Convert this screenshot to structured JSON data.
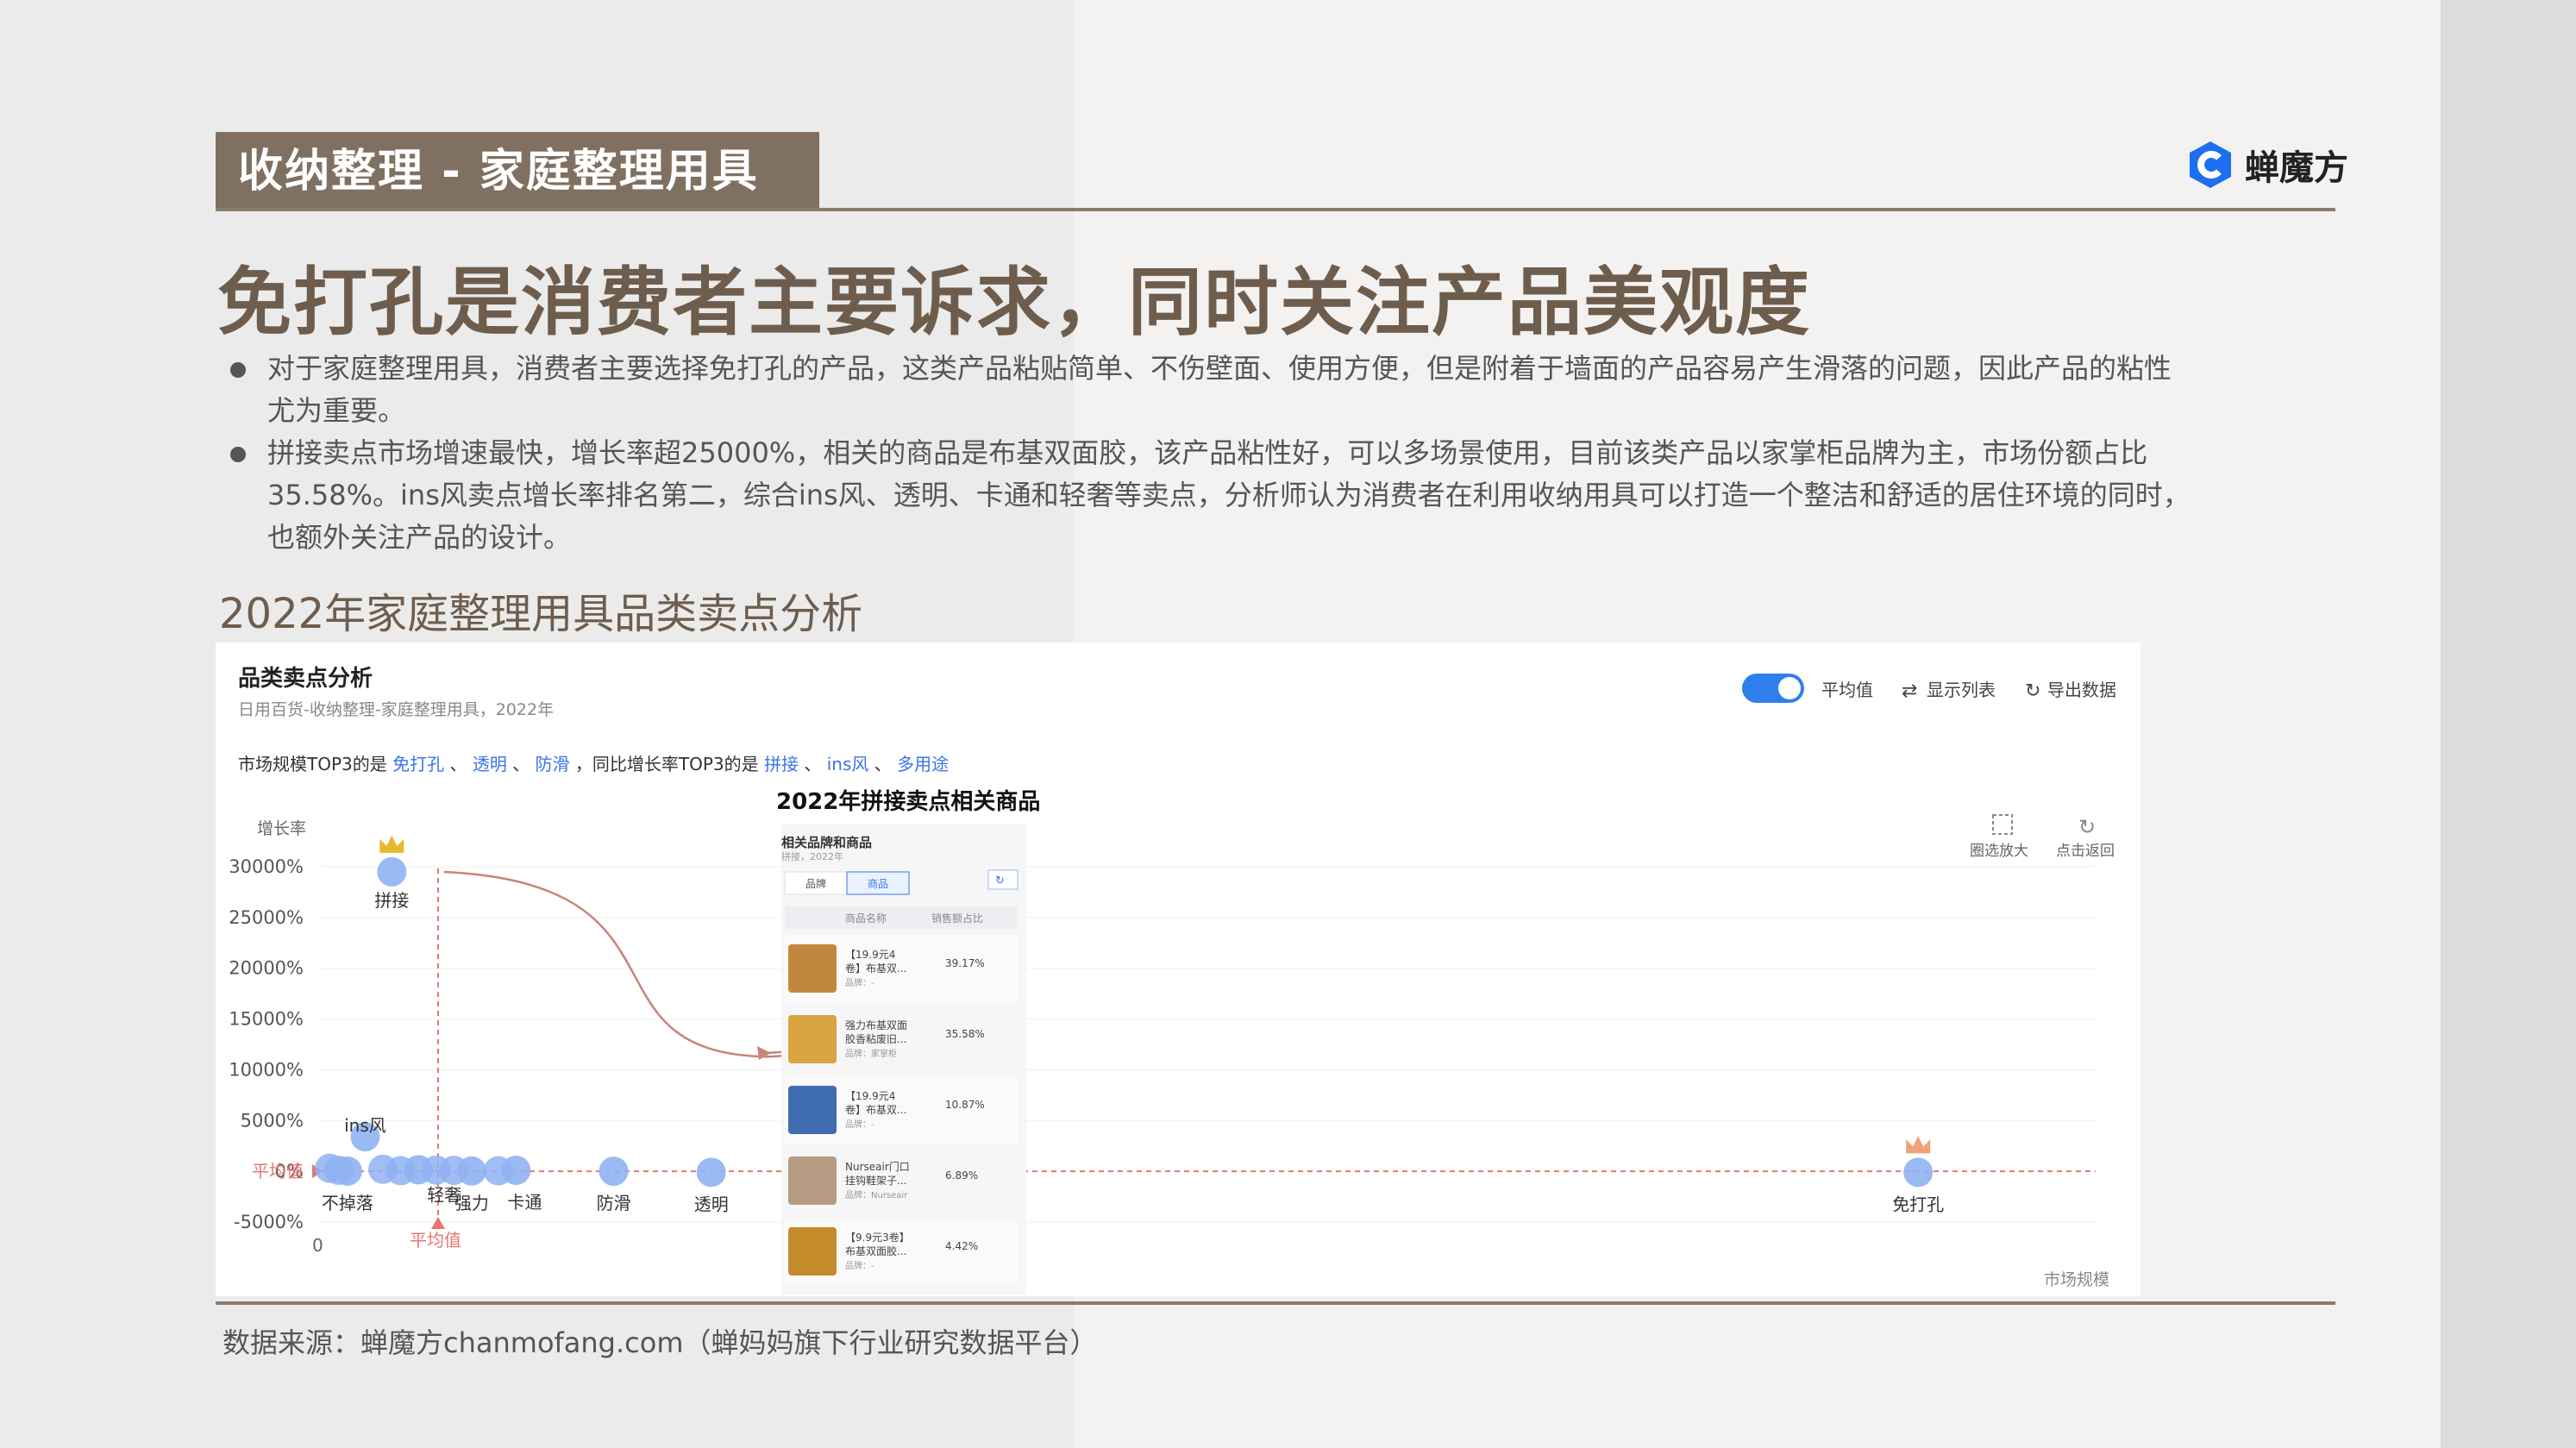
{
  "header": {
    "category_tag": "收纳整理 - 家庭整理用具",
    "brand_name": "蝉魔方"
  },
  "headline": "免打孔是消费者主要诉求，同时关注产品美观度",
  "bullets": [
    {
      "line1": "对于家庭整理用具，消费者主要选择免打孔的产品，这类产品粘贴简单、不伤壁面、使用方便，但是附着于墙面的产品容易产生滑落的问题，因此产品的粘性",
      "line2": "尤为重要。"
    },
    {
      "line1": "拼接卖点市场增速最快，增长率超25000%，相关的商品是布基双面胶，该产品粘性好，可以多场景使用，目前该类产品以家掌柜品牌为主，市场份额占比",
      "line2": "35.58%。ins风卖点增长率排名第二，综合ins风、透明、卡通和轻奢等卖点，分析师认为消费者在利用收纳用具可以打造一个整洁和舒适的居住环境的同时，",
      "line3": "也额外关注产品的设计。"
    }
  ],
  "section_title": "2022年家庭整理用具品类卖点分析",
  "panel": {
    "title": "品类卖点分析",
    "subtitle": "日用百货-收纳整理-家庭整理用具，2022年",
    "toggle_label": "平均值",
    "show_list_label": "显示列表",
    "export_label": "导出数据",
    "zoom_label": "圈选放大",
    "reset_label": "点击返回",
    "summary_prefix": "市场规模TOP3的是",
    "summary_top_size": [
      "免打孔",
      "透明",
      "防滑"
    ],
    "summary_mid": "，同比增长率TOP3的是",
    "summary_top_growth": [
      "拼接",
      "ins风",
      "多用途"
    ],
    "sep": "、"
  },
  "inset": {
    "caption": "2022年拼接卖点相关商品",
    "title": "相关品牌和商品",
    "subtitle": "拼接，2022年",
    "tabs": [
      "品牌",
      "商品"
    ],
    "col_name": "商品名称",
    "col_share": "销售额占比",
    "rows": [
      {
        "name1": "【19.9元4",
        "name2": "卷】布基双...",
        "brand": "品牌：-",
        "share": "39.17%",
        "color": "#c2873f"
      },
      {
        "name1": "强力布基双面",
        "name2": "胶香粘废旧...",
        "brand": "品牌：家掌柜",
        "share": "35.58%",
        "color": "#d9a441"
      },
      {
        "name1": "【19.9元4",
        "name2": "卷】布基双...",
        "brand": "品牌：-",
        "share": "10.87%",
        "color": "#3f6db0"
      },
      {
        "name1": "Nurseair门口",
        "name2": "挂钩鞋架子...",
        "brand": "品牌：Nurseair",
        "share": "6.89%",
        "color": "#b59c82"
      },
      {
        "name1": "【9.9元3卷】",
        "name2": "布基双面胶...",
        "brand": "品牌：-",
        "share": "4.42%",
        "color": "#c48a2c"
      }
    ]
  },
  "chart_data": {
    "type": "scatter",
    "ylabel": "增长率",
    "xlabel": "市场规模",
    "y_ticks": [
      "30000%",
      "25000%",
      "20000%",
      "15000%",
      "10000%",
      "5000%",
      "0%",
      "-5000%"
    ],
    "x_tick": "0",
    "ylim": [
      -5000,
      30000
    ],
    "avg_line_label": "平均值",
    "avg_x_label": "平均值",
    "grid": true,
    "points": [
      {
        "label": "拼接",
        "x": 0.04,
        "y": 29500,
        "crown": true
      },
      {
        "label": "ins风",
        "x": 0.025,
        "y": 3400
      },
      {
        "label": "不掉落",
        "x": 0.015,
        "y": 20
      },
      {
        "label": "轻奢",
        "x": 0.055,
        "y": 150
      },
      {
        "label": "强力",
        "x": 0.085,
        "y": 30
      },
      {
        "label": "卡通",
        "x": 0.11,
        "y": 100
      },
      {
        "label": "防滑",
        "x": 0.165,
        "y": 0
      },
      {
        "label": "透明",
        "x": 0.22,
        "y": -100
      },
      {
        "label": "免打孔",
        "x": 0.9,
        "y": -100,
        "crown": true
      }
    ]
  },
  "footer": {
    "source": "数据来源：蝉魔方chanmofang.com（蝉妈妈旗下行业研究数据平台）"
  },
  "colors": {
    "brand_brown": "#7f7061",
    "headline": "#6e5d4d",
    "dot": "#8fb2f2",
    "link": "#3b74e6",
    "avg_line": "#e7766f"
  }
}
